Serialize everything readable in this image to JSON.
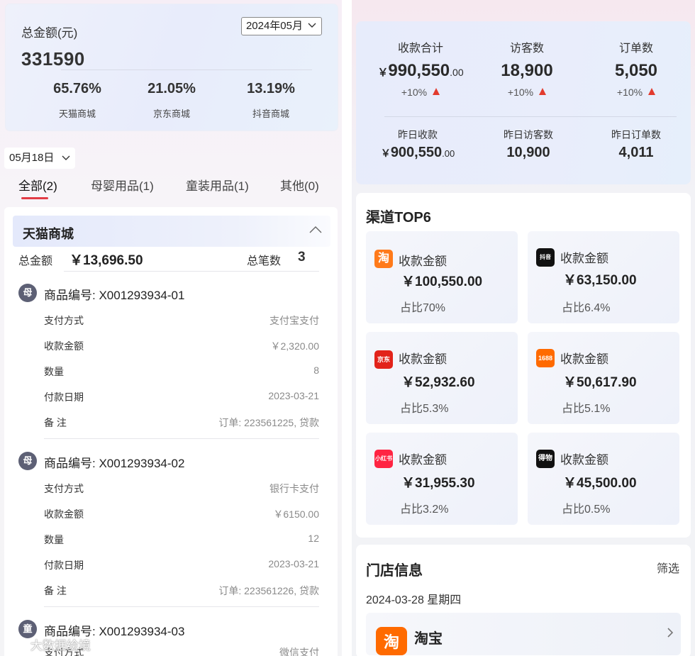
{
  "left": {
    "summary": {
      "title": "总金额(元)",
      "month": "2024年05月",
      "total": "331590",
      "shares": [
        {
          "pct": "65.76%",
          "label": "天猫商城"
        },
        {
          "pct": "21.05%",
          "label": "京东商城"
        },
        {
          "pct": "13.19%",
          "label": "抖音商城"
        }
      ]
    },
    "date_filter": "05月18日",
    "tabs": [
      "全部(2)",
      "母婴用品(1)",
      "童装用品(1)",
      "其他(0)"
    ],
    "store": {
      "name": "天猫商城",
      "total_label": "总金额",
      "total_amount": "￥13,696.50",
      "count_label": "总笔数",
      "count": "3"
    },
    "items": [
      {
        "badge": "母",
        "title": "商品编号: X001293934-01",
        "fields": [
          {
            "k": "支付方式",
            "v": "支付宝支付"
          },
          {
            "k": "收款金额",
            "v": "￥2,320.00"
          },
          {
            "k": "数量",
            "v": "8"
          },
          {
            "k": "付款日期",
            "v": "2023-03-21"
          },
          {
            "k": "备 注",
            "v": "订单: 223561225, 贷款"
          }
        ]
      },
      {
        "badge": "母",
        "title": "商品编号: X001293934-02",
        "fields": [
          {
            "k": "支付方式",
            "v": "银行卡支付"
          },
          {
            "k": "收款金额",
            "v": "￥6150.00"
          },
          {
            "k": "数量",
            "v": "12"
          },
          {
            "k": "付款日期",
            "v": "2023-03-21"
          },
          {
            "k": "备 注",
            "v": "订单: 223561226, 贷款"
          }
        ]
      },
      {
        "badge": "童",
        "title": "商品编号: X001293934-03",
        "fields": [
          {
            "k": "支付方式",
            "v": "微信支付"
          }
        ]
      }
    ],
    "watermark": "大数据绘境"
  },
  "right": {
    "stats": [
      {
        "label": "收款合计",
        "cur": "￥",
        "int": "990,550",
        "dec": ".00",
        "change": "+10%"
      },
      {
        "label": "访客数",
        "cur": "",
        "int": "18,900",
        "dec": "",
        "change": "+10%"
      },
      {
        "label": "订单数",
        "cur": "",
        "int": "5,050",
        "dec": "",
        "change": "+10%"
      }
    ],
    "yesterday": [
      {
        "label": "昨日收款",
        "cur": "￥",
        "int": "900,550",
        "dec": ".00"
      },
      {
        "label": "昨日访客数",
        "cur": "",
        "int": "10,900",
        "dec": ""
      },
      {
        "label": "昨日订单数",
        "cur": "",
        "int": "4,011",
        "dec": ""
      }
    ],
    "channels_title": "渠道TOP6",
    "channels": [
      {
        "icon": "taobao-icon",
        "glyph": "淘",
        "color": "#ff7a1a",
        "label": "收款金额",
        "amount": "￥100,550.00",
        "pct": "占比70%"
      },
      {
        "icon": "douyin-icon",
        "glyph": "抖音",
        "color": "#111111",
        "label": "收款金额",
        "amount": "￥63,150.00",
        "pct": "占比6.4%"
      },
      {
        "icon": "jd-icon",
        "glyph": "京东",
        "color": "#e2231a",
        "label": "收款金额",
        "amount": "￥52,932.60",
        "pct": "占比5.3%"
      },
      {
        "icon": "1688-icon",
        "glyph": "1688",
        "color": "#ff6a00",
        "label": "收款金额",
        "amount": "￥50,617.90",
        "pct": "占比5.1%"
      },
      {
        "icon": "xiaohongshu-icon",
        "glyph": "小红书",
        "color": "#ff2442",
        "label": "收款金额",
        "amount": "￥31,955.30",
        "pct": "占比3.2%"
      },
      {
        "icon": "dewu-icon",
        "glyph": "得物",
        "color": "#111111",
        "label": "收款金额",
        "amount": "￥45,500.00",
        "pct": "占比0.5%"
      }
    ],
    "shop": {
      "title": "门店信息",
      "filter": "筛选",
      "date": "2024-03-28  星期四",
      "name": "淘宝",
      "logo_glyph": "淘"
    }
  }
}
